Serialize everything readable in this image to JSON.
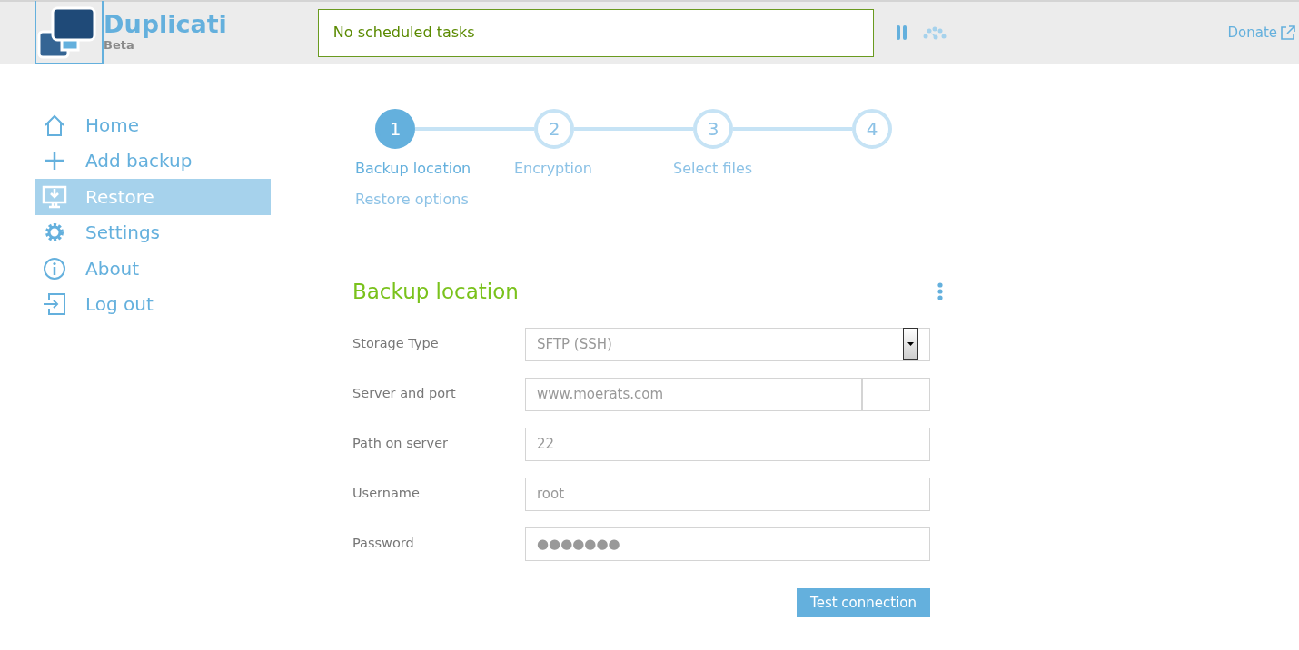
{
  "header": {
    "app_name": "Duplicati",
    "subtitle": "Beta",
    "status": "No scheduled tasks",
    "paused": false,
    "donate": "Donate"
  },
  "sidebar": {
    "items": [
      {
        "label": "Home",
        "kind": "home",
        "selected": false
      },
      {
        "label": "Add backup",
        "kind": "add",
        "selected": false
      },
      {
        "label": "Restore",
        "kind": "restore",
        "selected": true
      },
      {
        "label": "Settings",
        "kind": "settings",
        "selected": false
      },
      {
        "label": "About",
        "kind": "about",
        "selected": false
      },
      {
        "label": "Log out",
        "kind": "logout",
        "selected": false
      }
    ]
  },
  "wizard": {
    "steps": [
      {
        "number": "1",
        "label": "Backup location",
        "selected": true
      },
      {
        "number": "2",
        "label": "Encryption",
        "selected": false
      },
      {
        "number": "3",
        "label": "Select files",
        "selected": false
      },
      {
        "number": "4",
        "label": "Restore options",
        "selected": false
      }
    ]
  },
  "form": {
    "title": "Backup location",
    "fields": [
      {
        "kind": "select",
        "label": "Storage Type",
        "value": "SFTP (SSH)"
      },
      {
        "kind": "hostport",
        "label": "Server and port",
        "value": "www.moerats.com"
      },
      {
        "kind": "text",
        "label": "Path on server",
        "value": "22"
      },
      {
        "kind": "text",
        "label": "Username",
        "value": "root"
      },
      {
        "kind": "text",
        "label": "Password",
        "value": "●●●●●●●"
      }
    ],
    "button": "Test connection"
  }
}
